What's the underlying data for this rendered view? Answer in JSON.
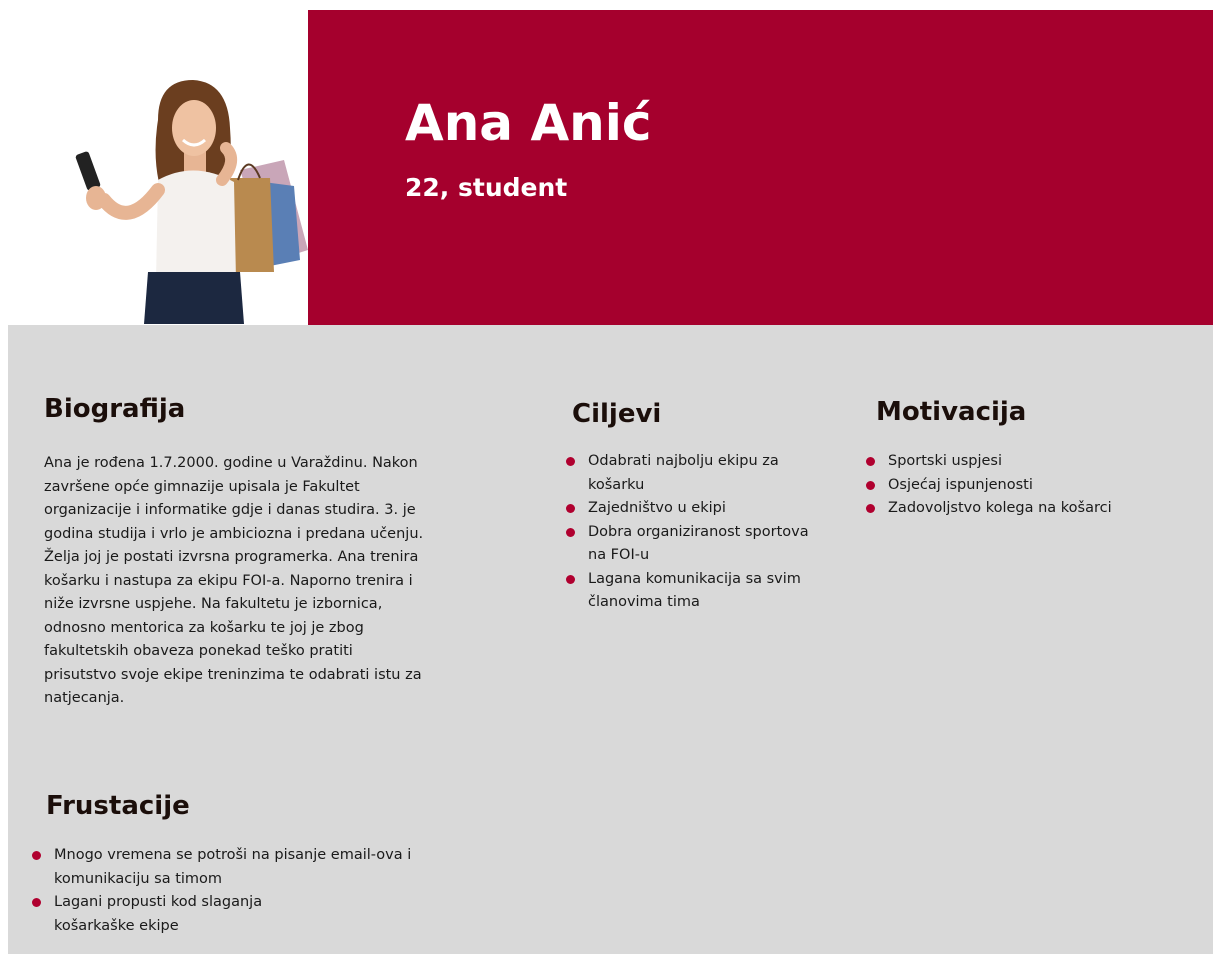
{
  "colors": {
    "accent": "#a5002d",
    "body_background": "#d9d9d9",
    "bullet": "#b0002f"
  },
  "header": {
    "photo": "woman-with-shopping-bags-photo",
    "name": "Ana Anić",
    "subtitle": "22, student"
  },
  "biography": {
    "title": "Biografija",
    "text": "Ana je rođena 1.7.2000. godine u Varaždinu. Nakon završene opće gimnazije upisala je Fakultet organizacije i informatike gdje i danas studira. 3. je godina studija i vrlo je ambiciozna i predana učenju. Želja joj je postati izvrsna programerka. Ana trenira košarku i nastupa za ekipu FOI-a. Naporno trenira i niže izvrsne uspjehe. Na fakultetu je izbornica, odnosno mentorica za košarku te joj je zbog fakultetskih obaveza ponekad teško pratiti prisutstvo svoje ekipe treninzima te odabrati istu za natjecanja."
  },
  "goals": {
    "title": "Ciljevi",
    "items": [
      "Odabrati najbolju ekipu za košarku",
      "Zajedništvo u ekipi",
      "Dobra organiziranost sportova na FOI-u",
      "Lagana komunikacija sa svim članovima tima"
    ]
  },
  "motivation": {
    "title": "Motivacija",
    "items": [
      "Sportski uspjesi",
      "Osjećaj ispunjenosti",
      "Zadovoljstvo kolega na košarci"
    ]
  },
  "frustrations": {
    "title": "Frustacije",
    "items": [
      "Mnogo vremena se potroši na pisanje email-ova i komunikaciju sa timom",
      "Lagani propusti kod slaganja košarkaške ekipe"
    ]
  }
}
